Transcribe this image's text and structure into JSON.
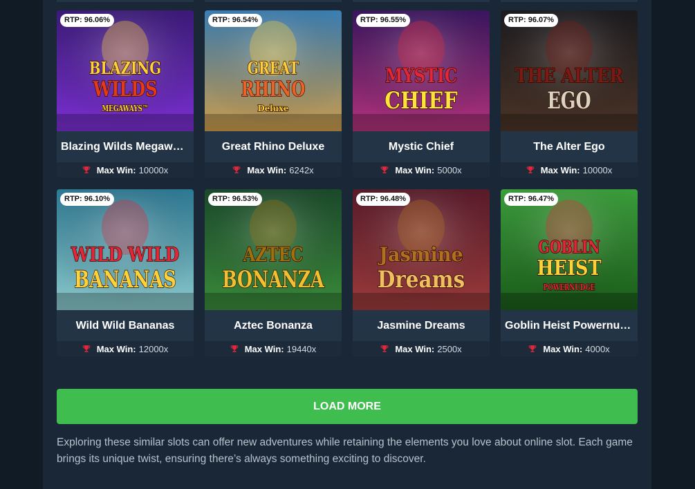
{
  "games": [
    {
      "rtp": "RTP: 96.06%",
      "title": "Blazing Wilds Megawa…",
      "max_win_label": "Max Win:",
      "max_win": "10000x",
      "logo": [
        "BLAZING",
        "WILDS",
        "MEGAWAYS™"
      ],
      "colors": [
        "#3b1a7a",
        "#7a2fd0",
        "#e23a1a",
        "#ffd23a"
      ]
    },
    {
      "rtp": "RTP: 96.54%",
      "title": "Great Rhino Deluxe",
      "max_win_label": "Max Win:",
      "max_win": "6242x",
      "logo": [
        "GREAT",
        "RHINO",
        "Deluxe"
      ],
      "colors": [
        "#3a7fb5",
        "#c99a4a",
        "#e8632a",
        "#ffcf3a"
      ]
    },
    {
      "rtp": "RTP: 96.55%",
      "title": "Mystic Chief",
      "max_win_label": "Max Win:",
      "max_win": "5000x",
      "logo": [
        "MYSTIC",
        "CHIEF",
        ""
      ],
      "colors": [
        "#3a1560",
        "#b0327a",
        "#ffe23a",
        "#e0283a"
      ]
    },
    {
      "rtp": "RTP: 96.07%",
      "title": "The Alter Ego",
      "max_win_label": "Max Win:",
      "max_win": "10000x",
      "logo": [
        "THE ALTER",
        "EGO",
        ""
      ],
      "colors": [
        "#1b1a1e",
        "#4a3326",
        "#dcd4c0",
        "#7b1a14"
      ]
    },
    {
      "rtp": "RTP: 96.10%",
      "title": "Wild Wild Bananas",
      "max_win_label": "Max Win:",
      "max_win": "12000x",
      "logo": [
        "WILD WILD",
        "BANANAS",
        ""
      ],
      "colors": [
        "#2d7a95",
        "#8ac7c9",
        "#ffd23a",
        "#e0283a"
      ]
    },
    {
      "rtp": "RTP: 96.53%",
      "title": "Aztec Bonanza",
      "max_win_label": "Max Win:",
      "max_win": "19440x",
      "logo": [
        "AZTEC",
        "BONANZA",
        ""
      ],
      "colors": [
        "#1a4a2a",
        "#3a8a3a",
        "#f0c030",
        "#a07010"
      ]
    },
    {
      "rtp": "RTP: 96.48%",
      "title": "Jasmine Dreams",
      "max_win_label": "Max Win:",
      "max_win": "2500x",
      "logo": [
        "Jasmine",
        "Dreams",
        ""
      ],
      "colors": [
        "#5a1a2a",
        "#9a3a3a",
        "#f0c060",
        "#b07020"
      ]
    },
    {
      "rtp": "RTP: 96.47%",
      "title": "Goblin Heist Powernud…",
      "max_win_label": "Max Win:",
      "max_win": "4000x",
      "logo": [
        "GOBLIN",
        "HEIST",
        "POWERNUDGE"
      ],
      "colors": [
        "#3aa03a",
        "#1a5a1a",
        "#ffd23a",
        "#e0283a"
      ]
    }
  ],
  "load_more_label": "LOAD MORE",
  "description": "Exploring these similar slots can offer new adventures while retaining the elements you love about online slot. Each game brings its unique twist, ensuring there’s always something exciting to discover.",
  "trophy_icon": "trophy-icon",
  "accent": "#3fbe4f"
}
